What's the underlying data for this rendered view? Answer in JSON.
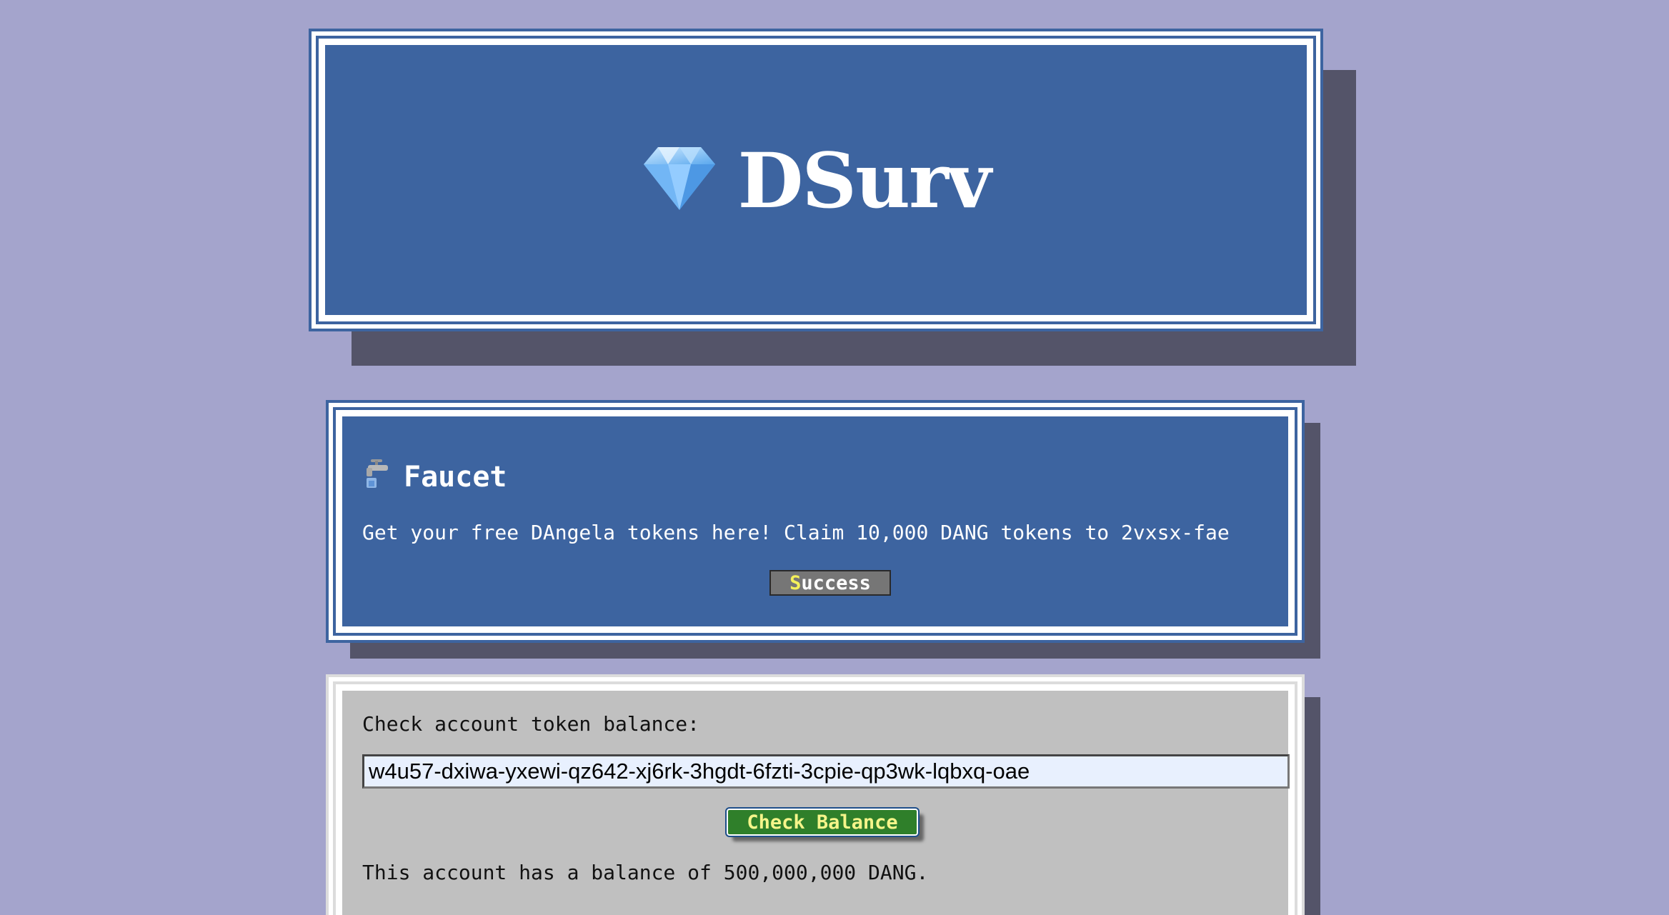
{
  "header": {
    "brand": "DSurv",
    "logo_icon": "gem-icon"
  },
  "faucet": {
    "icon": "faucet-icon",
    "title": "Faucet",
    "description": "Get your free DAngela tokens here! Claim 10,000 DANG tokens to 2vxsx-fae",
    "button_hotkey": "S",
    "button_rest": "uccess"
  },
  "balance": {
    "label": "Check account token balance:",
    "account_value": "w4u57-dxiwa-yxewi-qz642-xj6rk-3hgdt-6fzti-3cpie-qp3wk-lqbxq-oae",
    "button_label": "Check Balance",
    "result": "This account has a balance of 500,000,000 DANG."
  },
  "colors": {
    "background": "#a4a4cc",
    "panel_blue": "#3d64a0",
    "panel_gray": "#c0c0c0",
    "check_button": "#2f7f2a"
  }
}
